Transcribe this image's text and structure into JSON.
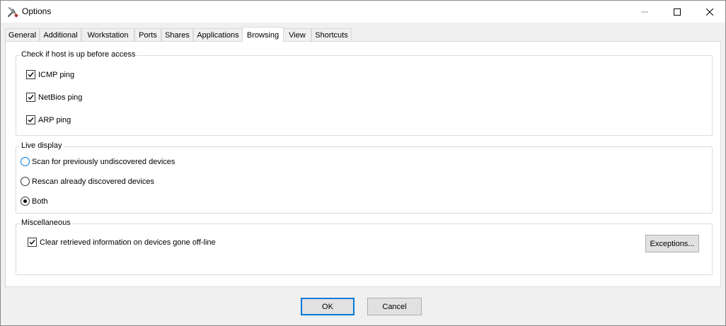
{
  "window": {
    "title": "Options"
  },
  "tabs": [
    "General",
    "Additional",
    "Workstation",
    "Ports",
    "Shares",
    "Applications",
    "Browsing",
    "View",
    "Shortcuts"
  ],
  "active_tab": "Browsing",
  "groups": {
    "host_check": {
      "title": "Check if host is up before access",
      "items": [
        {
          "label": "ICMP ping",
          "checked": true
        },
        {
          "label": "NetBios ping",
          "checked": true
        },
        {
          "label": "ARP ping",
          "checked": true
        }
      ]
    },
    "live_display": {
      "title": "Live display",
      "options": [
        {
          "label": "Scan for previously undiscovered devices",
          "selected": false
        },
        {
          "label": "Rescan already discovered devices",
          "selected": false
        },
        {
          "label": "Both",
          "selected": true
        }
      ]
    },
    "misc": {
      "title": "Miscellaneous",
      "clear_label": "Clear retrieved information on devices gone off-line",
      "clear_checked": true,
      "exceptions_label": "Exceptions..."
    }
  },
  "footer": {
    "ok_label": "OK",
    "cancel_label": "Cancel"
  },
  "colors": {
    "accent": "#0078d7",
    "panel": "#ffffff",
    "chrome": "#f0f0f0"
  }
}
